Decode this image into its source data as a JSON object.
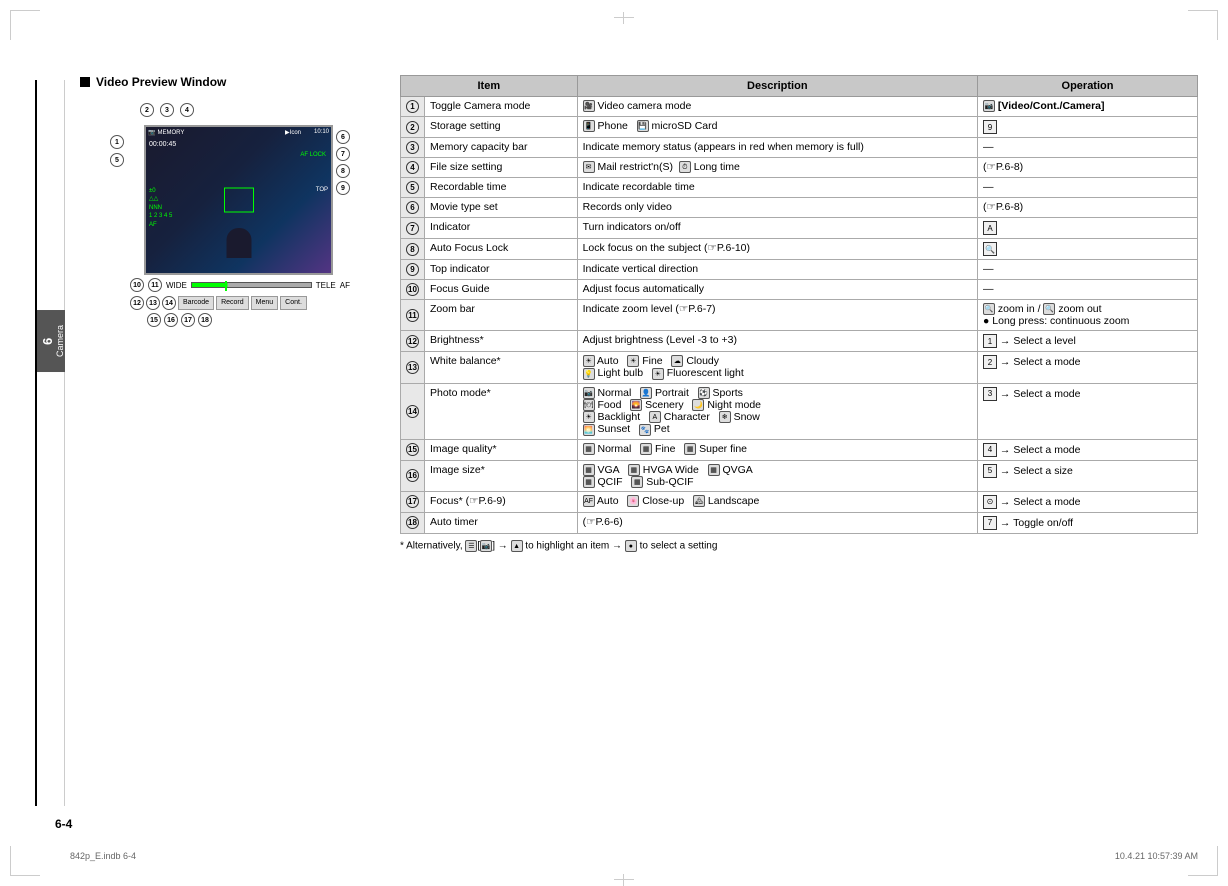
{
  "page": {
    "number": "6-4",
    "file_info_left": "842p_E.indb   6-4",
    "file_info_right": "10.4.21   10:57:39 AM"
  },
  "chapter": {
    "number": "6",
    "label": "Camera"
  },
  "section": {
    "title": "Video Preview Window"
  },
  "table": {
    "headers": [
      "Item",
      "Description",
      "Operation"
    ],
    "rows": [
      {
        "num": "1",
        "item": "Toggle Camera mode",
        "desc": "Video camera mode",
        "op": "[Video/Cont./Camera]"
      },
      {
        "num": "2",
        "item": "Storage setting",
        "desc": "Phone  microSD Card",
        "op": "9"
      },
      {
        "num": "3",
        "item": "Memory capacity bar",
        "desc": "Indicate memory status (appears in red when memory is full)",
        "op": "—"
      },
      {
        "num": "4",
        "item": "File size setting",
        "desc": "Mail restrict'n(S)  Long time",
        "op": "(☞P.6-8)"
      },
      {
        "num": "5",
        "item": "Recordable time",
        "desc": "Indicate recordable time",
        "op": "—"
      },
      {
        "num": "6",
        "item": "Movie type set",
        "desc": "Records only video",
        "op": "(☞P.6-8)"
      },
      {
        "num": "7",
        "item": "Indicator",
        "desc": "Turn indicators on/off",
        "op": "A"
      },
      {
        "num": "8",
        "item": "Auto Focus Lock",
        "desc": "Lock focus on the subject (☞P.6-10)",
        "op": "🔍"
      },
      {
        "num": "9",
        "item": "Top indicator",
        "desc": "Indicate vertical direction",
        "op": "—"
      },
      {
        "num": "10",
        "item": "Focus Guide",
        "desc": "Adjust focus automatically",
        "op": "—"
      },
      {
        "num": "11",
        "item": "Zoom bar",
        "desc": "Indicate zoom level (☞P.6-7)",
        "op": "zoom in / zoom out\n● Long press: continuous zoom"
      },
      {
        "num": "12",
        "item": "Brightness*",
        "desc": "Adjust brightness (Level -3 to +3)",
        "op": "1 → Select a level"
      },
      {
        "num": "13",
        "item": "White balance*",
        "desc": "Auto  Fine  Cloudy\nLight bulb  Fluorescent light",
        "op": "2 → Select a mode"
      },
      {
        "num": "14",
        "item": "Photo mode*",
        "desc": "Normal  Portrait  Sports\nFood  Scenery  Night mode\nBacklight  Character  Snow\nSunset  Pet",
        "op": "3 → Select a mode"
      },
      {
        "num": "15",
        "item": "Image quality*",
        "desc": "Normal  Fine  Super fine",
        "op": "4 → Select a mode"
      },
      {
        "num": "16",
        "item": "Image size*",
        "desc": "VGA  HVGA Wide  QVGA\nQCIF  Sub-QCIF",
        "op": "5 → Select a size"
      },
      {
        "num": "17",
        "item": "Focus* (☞P.6-9)",
        "desc": "Auto  Close-up  Landscape",
        "op": "⊙ → Select a mode"
      },
      {
        "num": "18",
        "item": "Auto timer",
        "desc": "(☞P.6-6)",
        "op": "7 → Toggle on/off"
      }
    ],
    "footnote": "* Alternatively,  [  ] →  to highlight an item →  to select a setting"
  },
  "camera_preview": {
    "time": "00:00:45",
    "memory_label": "MEMORY",
    "time_indicator": "10:10",
    "af_lock": "AF LOCK",
    "wide_label": "WIDE",
    "tele_label": "TELE",
    "af_label": "AF",
    "button_labels": [
      "Barcode",
      "Record",
      "Menu",
      "Cont."
    ],
    "callout_positions": [
      2,
      3,
      4,
      5,
      6,
      7,
      8,
      9,
      10,
      11,
      12,
      13,
      14,
      15,
      16,
      17,
      18
    ]
  }
}
